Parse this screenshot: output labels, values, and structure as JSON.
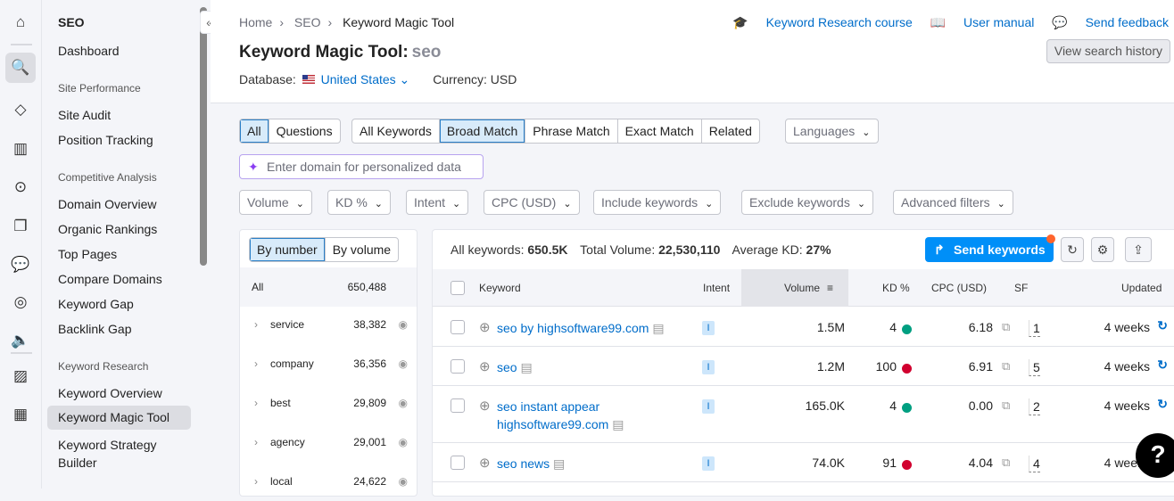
{
  "sidebar": {
    "title": "SEO",
    "dashboard": "Dashboard",
    "sections": [
      {
        "header": "Site Performance",
        "items": [
          "Site Audit",
          "Position Tracking"
        ]
      },
      {
        "header": "Competitive Analysis",
        "items": [
          "Domain Overview",
          "Organic Rankings",
          "Top Pages",
          "Compare Domains",
          "Keyword Gap",
          "Backlink Gap"
        ]
      },
      {
        "header": "Keyword Research",
        "items": [
          "Keyword Overview",
          "Keyword Magic Tool",
          "Keyword Strategy Builder"
        ]
      }
    ]
  },
  "breadcrumb": [
    "Home",
    "SEO",
    "Keyword Magic Tool"
  ],
  "header": {
    "title": "Keyword Magic Tool:",
    "query": "seo",
    "database_label": "Database:",
    "database": "United States",
    "currency": "Currency: USD",
    "links": [
      "Keyword Research course",
      "User manual",
      "Send feedback"
    ],
    "view_history": "View search history"
  },
  "filters": {
    "question_tabs": [
      "All",
      "Questions"
    ],
    "match_tabs": [
      "All Keywords",
      "Broad Match",
      "Phrase Match",
      "Exact Match",
      "Related"
    ],
    "languages": "Languages",
    "domain_placeholder": "Enter domain for personalized data",
    "dropdowns": [
      "Volume",
      "KD %",
      "Intent",
      "CPC (USD)",
      "Include keywords",
      "Exclude keywords",
      "Advanced filters"
    ]
  },
  "groups": {
    "tabs": [
      "By number",
      "By volume"
    ],
    "all_label": "All",
    "all_count": "650,488",
    "items": [
      {
        "k": "service",
        "n": "38,382"
      },
      {
        "k": "company",
        "n": "36,356"
      },
      {
        "k": "best",
        "n": "29,809"
      },
      {
        "k": "agency",
        "n": "29,001"
      },
      {
        "k": "local",
        "n": "24,622"
      }
    ]
  },
  "summary": {
    "all_label": "All keywords:",
    "all": "650.5K",
    "vol_label": "Total Volume:",
    "vol": "22,530,110",
    "kd_label": "Average KD:",
    "kd": "27%",
    "send": "Send keywords"
  },
  "table": {
    "columns": [
      "Keyword",
      "Intent",
      "Volume",
      "KD %",
      "CPC (USD)",
      "SF",
      "Updated"
    ],
    "rows": [
      {
        "keyword": "seo by highsoftware99.com",
        "intent": "I",
        "volume": "1.5M",
        "kd": "4",
        "kd_color": "#009f81",
        "cpc": "6.18",
        "sf": "1",
        "updated": "4 weeks"
      },
      {
        "keyword": "seo",
        "intent": "I",
        "volume": "1.2M",
        "kd": "100",
        "kd_color": "#d1002f",
        "cpc": "6.91",
        "sf": "5",
        "updated": "4 weeks"
      },
      {
        "keyword": "seo instant appear highsoftware99.com",
        "intent": "I",
        "volume": "165.0K",
        "kd": "4",
        "kd_color": "#009f81",
        "cpc": "0.00",
        "sf": "2",
        "updated": "4 weeks"
      },
      {
        "keyword": "seo news",
        "intent": "I",
        "volume": "74.0K",
        "kd": "91",
        "kd_color": "#d1002f",
        "cpc": "4.04",
        "sf": "4",
        "updated": "4 weeks"
      }
    ]
  },
  "help": "?"
}
